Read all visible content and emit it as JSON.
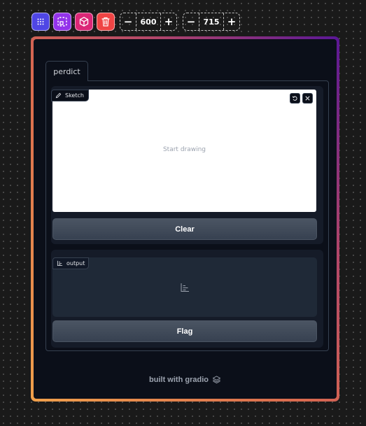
{
  "toolbar": {
    "buttons": [
      {
        "icon": "grid-icon",
        "color": "#4f46e5"
      },
      {
        "icon": "crop-select-icon",
        "color": "#9333ea"
      },
      {
        "icon": "cube-icon",
        "color": "#db2777"
      },
      {
        "icon": "trash-icon",
        "color": "#ef4444"
      }
    ],
    "width_value": "600",
    "height_value": "715",
    "minus": "−",
    "plus": "+"
  },
  "app": {
    "tab_label": "perdict",
    "sketch": {
      "label": "Sketch",
      "placeholder": "Start drawing"
    },
    "clear_label": "Clear",
    "output": {
      "label": "output"
    },
    "flag_label": "Flag",
    "footer_text": "built with gradio"
  },
  "colors": {
    "app_bg": "#0b0f19",
    "button_bg": "#4b5563",
    "frame_gradient": [
      "#f0a04b",
      "#d9694f",
      "#b2466a",
      "#5a1796"
    ]
  }
}
